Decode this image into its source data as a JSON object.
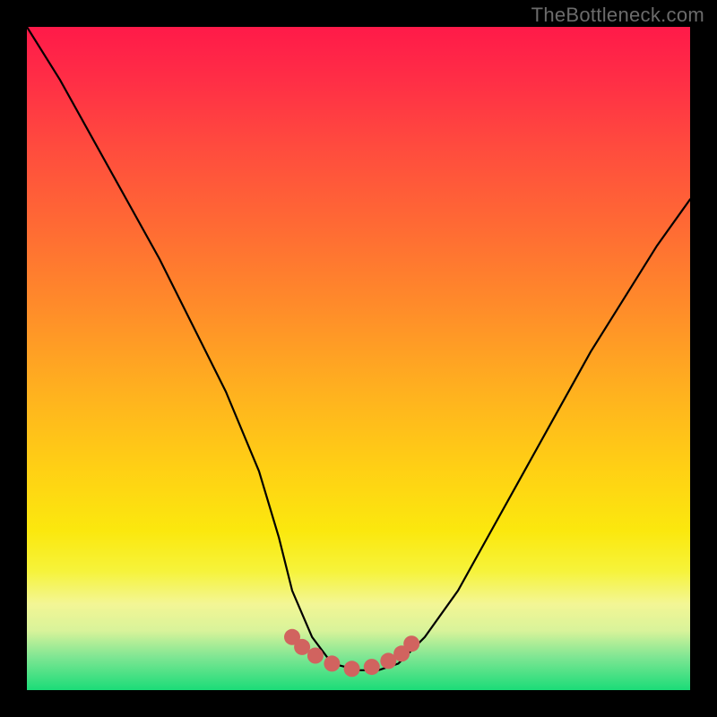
{
  "watermark": "TheBottleneck.com",
  "chart_data": {
    "type": "line",
    "title": "",
    "xlabel": "",
    "ylabel": "",
    "xlim": [
      0,
      100
    ],
    "ylim": [
      0,
      100
    ],
    "grid": false,
    "legend": false,
    "series": [
      {
        "name": "bottleneck-curve",
        "x": [
          0,
          5,
          10,
          15,
          20,
          25,
          30,
          35,
          38,
          40,
          43,
          46,
          50,
          53,
          56,
          60,
          65,
          70,
          75,
          80,
          85,
          90,
          95,
          100
        ],
        "values": [
          100,
          92,
          83,
          74,
          65,
          55,
          45,
          33,
          23,
          15,
          8,
          4,
          3,
          3,
          4,
          8,
          15,
          24,
          33,
          42,
          51,
          59,
          67,
          74
        ]
      }
    ],
    "markers": {
      "name": "highlight-points",
      "color": "#d1635f",
      "x": [
        40,
        41.5,
        43.5,
        46,
        49,
        52,
        54.5,
        56.5,
        58
      ],
      "values": [
        8,
        6.5,
        5.2,
        4,
        3.2,
        3.5,
        4.4,
        5.5,
        7
      ]
    },
    "background_gradient": {
      "top": "#ff1a49",
      "bottom": "#1bdc78",
      "description": "vertical red-orange-yellow-green gradient"
    }
  }
}
